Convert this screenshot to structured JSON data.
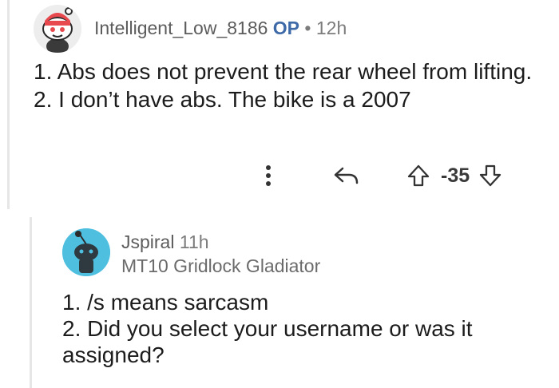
{
  "comment1": {
    "username": "Intelligent_Low_8186",
    "op_badge": "OP",
    "separator": "•",
    "time": "12h",
    "body": "1. Abs does not prevent the rear wheel from lifting. 2. I don’t have abs. The bike is a 2007",
    "score": "-35",
    "icons": [
      "avatar-snoo-icon",
      "more-vertical-icon",
      "reply-icon",
      "upvote-icon",
      "downvote-icon"
    ]
  },
  "comment2": {
    "username": "Jspiral",
    "time": "11h",
    "flair": "MT10 Gridlock Gladiator",
    "body_lines": [
      "1. /s means sarcasm",
      "2. Did you select your username or was it assigned?"
    ],
    "icons": [
      "avatar-snoo-icon"
    ]
  },
  "colors": {
    "op_blue": "#3f6aa8",
    "avatar2_bg": "#4fbfe0",
    "thread_line": "#e6e6e6"
  }
}
